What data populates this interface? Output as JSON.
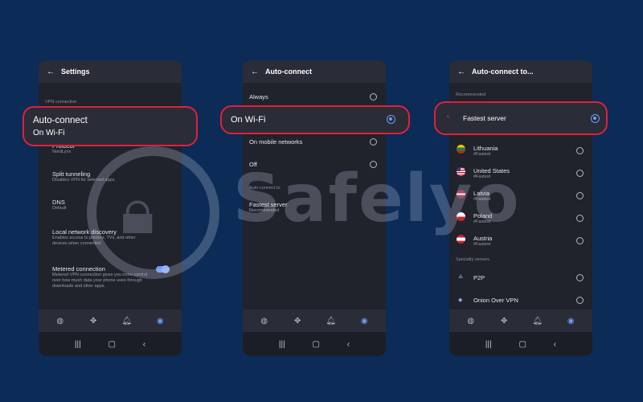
{
  "screen1": {
    "title": "Settings",
    "section": "VPN connection",
    "callout": {
      "title": "Auto-connect",
      "subtitle": "On Wi-Fi"
    },
    "items": [
      {
        "title": "Protocol",
        "sub": "NordLynx"
      },
      {
        "title": "Split tunneling",
        "sub": "Disables VPN for selected apps."
      },
      {
        "title": "DNS",
        "sub": "Default"
      },
      {
        "title": "Local network discovery",
        "sub": "Enables access to printers, TVs, and other devices when connected."
      },
      {
        "title": "Metered connection",
        "sub": "Metered VPN connection gives you more control over how much data your phone uses through downloads and other apps."
      }
    ]
  },
  "screen2": {
    "title": "Auto-connect",
    "options": [
      "Always",
      "On Wi-Fi",
      "On mobile networks",
      "Off"
    ],
    "selected": "On Wi-Fi",
    "section": "Auto-connect to",
    "target": {
      "title": "Fastest server",
      "sub": "Recommended"
    }
  },
  "screen3": {
    "title": "Auto-connect to...",
    "section_recommended": "Recommended",
    "fastest": "Fastest server",
    "countries": [
      {
        "name": "Lithuania",
        "sub": "#Fastest",
        "flag": "lt"
      },
      {
        "name": "United States",
        "sub": "#Fastest",
        "flag": "us"
      },
      {
        "name": "Latvia",
        "sub": "#Fastest",
        "flag": "lv"
      },
      {
        "name": "Poland",
        "sub": "#Fastest",
        "flag": "pl"
      },
      {
        "name": "Austria",
        "sub": "#Fastest",
        "flag": "at"
      }
    ],
    "section_specialty": "Specialty servers",
    "specialty": [
      {
        "name": "P2P",
        "icon": "p2p-icon"
      },
      {
        "name": "Onion Over VPN",
        "icon": "onion-icon"
      }
    ]
  },
  "nav_icons": [
    "globe-icon",
    "mesh-icon",
    "bell-icon",
    "profile-icon"
  ],
  "sys_icons": [
    "recents-icon",
    "home-icon",
    "back-icon"
  ],
  "watermark": "Safelyo",
  "colors": {
    "background": "#0c2b57",
    "accent": "#6e9cf5",
    "highlight": "#e0203b"
  }
}
